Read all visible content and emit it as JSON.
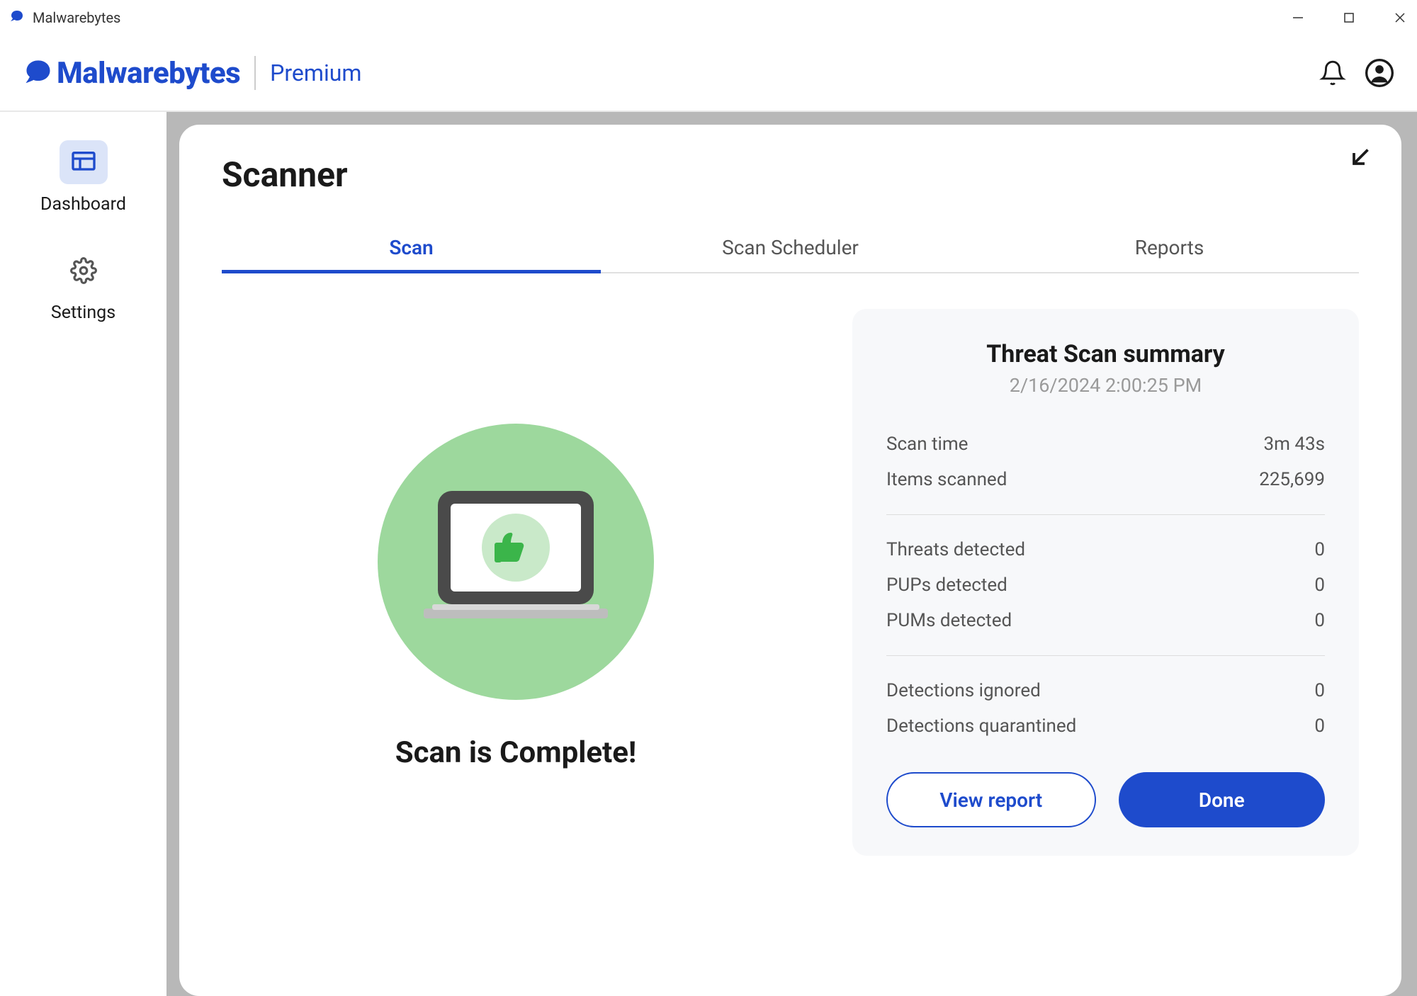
{
  "window": {
    "title": "Malwarebytes"
  },
  "header": {
    "brand": "Malwarebytes",
    "suffix": "Premium"
  },
  "sidebar": {
    "dashboard": "Dashboard",
    "settings": "Settings"
  },
  "page": {
    "title": "Scanner"
  },
  "tabs": {
    "scan": "Scan",
    "scheduler": "Scan Scheduler",
    "reports": "Reports"
  },
  "visual": {
    "status": "Scan is Complete!"
  },
  "summary": {
    "title": "Threat Scan summary",
    "date": "2/16/2024 2:00:25 PM",
    "rows1": [
      {
        "label": "Scan time",
        "value": "3m 43s"
      },
      {
        "label": "Items scanned",
        "value": "225,699"
      }
    ],
    "rows2": [
      {
        "label": "Threats detected",
        "value": "0"
      },
      {
        "label": "PUPs detected",
        "value": "0"
      },
      {
        "label": "PUMs detected",
        "value": "0"
      }
    ],
    "rows3": [
      {
        "label": "Detections ignored",
        "value": "0"
      },
      {
        "label": "Detections quarantined",
        "value": "0"
      }
    ]
  },
  "buttons": {
    "view_report": "View report",
    "done": "Done"
  }
}
